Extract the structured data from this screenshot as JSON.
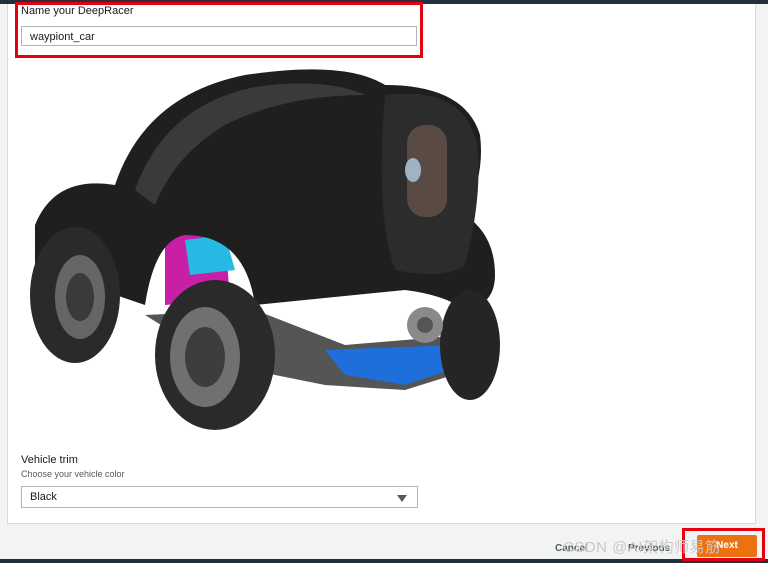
{
  "form": {
    "name_label": "Name your DeepRacer",
    "name_value": "waypiont_car",
    "trim_title": "Vehicle trim",
    "trim_subtitle": "Choose your vehicle color",
    "trim_selected": "Black"
  },
  "footer": {
    "cancel_label": "Cancel",
    "previous_label": "Previous",
    "next_label": "Next"
  },
  "watermark": "CSDN @AI架构师易筋",
  "colors": {
    "highlight": "#e4000f",
    "primary_button": "#ec7211"
  },
  "icons": {
    "select_caret": "caret-down-icon"
  }
}
